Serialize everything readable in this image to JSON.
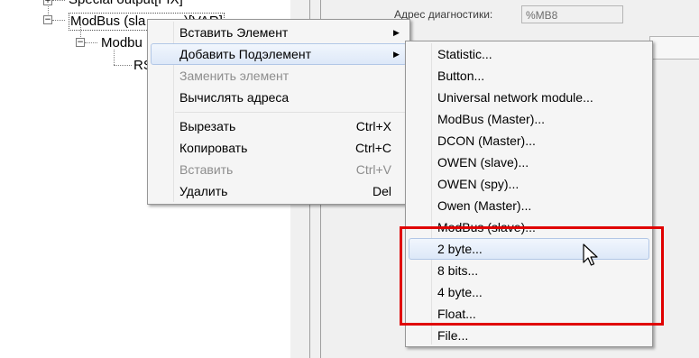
{
  "tree": {
    "nodes": [
      {
        "label": "Special output[FIX]"
      },
      {
        "label": "ModBus (sla",
        "suffix": "...)[VAR]"
      },
      {
        "label": "Modbu"
      },
      {
        "label": "RS"
      }
    ]
  },
  "properties": {
    "diag_label": "Адрес диагностики:",
    "diag_value": "%MB8"
  },
  "context_menu": {
    "items": [
      {
        "label": "Вставить Элемент",
        "submenu": true,
        "disabled": false
      },
      {
        "label": "Добавить Подэлемент",
        "submenu": true,
        "disabled": false,
        "highlighted": true
      },
      {
        "label": "Заменить элемент",
        "disabled": true
      },
      {
        "label": "Вычислять адреса",
        "disabled": false
      },
      {
        "label": "Вырезать",
        "shortcut": "Ctrl+X",
        "disabled": false
      },
      {
        "label": "Копировать",
        "shortcut": "Ctrl+C",
        "disabled": false
      },
      {
        "label": "Вставить",
        "shortcut": "Ctrl+V",
        "disabled": true
      },
      {
        "label": "Удалить",
        "shortcut": "Del",
        "disabled": false
      }
    ]
  },
  "submenu": {
    "items": [
      {
        "label": "Statistic..."
      },
      {
        "label": "Button..."
      },
      {
        "label": "Universal network module..."
      },
      {
        "label": "ModBus (Master)..."
      },
      {
        "label": "DCON (Master)..."
      },
      {
        "label": "OWEN (slave)..."
      },
      {
        "label": "OWEN (spy)..."
      },
      {
        "label": "Owen (Master)..."
      },
      {
        "label": "ModBus (slave)..."
      },
      {
        "label": "2 byte...",
        "highlighted": true
      },
      {
        "label": "8 bits..."
      },
      {
        "label": "4 byte..."
      },
      {
        "label": "Float..."
      },
      {
        "label": "File..."
      }
    ]
  },
  "colors": {
    "highlight_box": "#e00000",
    "menu_background": "#f5f5f5",
    "menu_hover": "#dde8f8"
  }
}
